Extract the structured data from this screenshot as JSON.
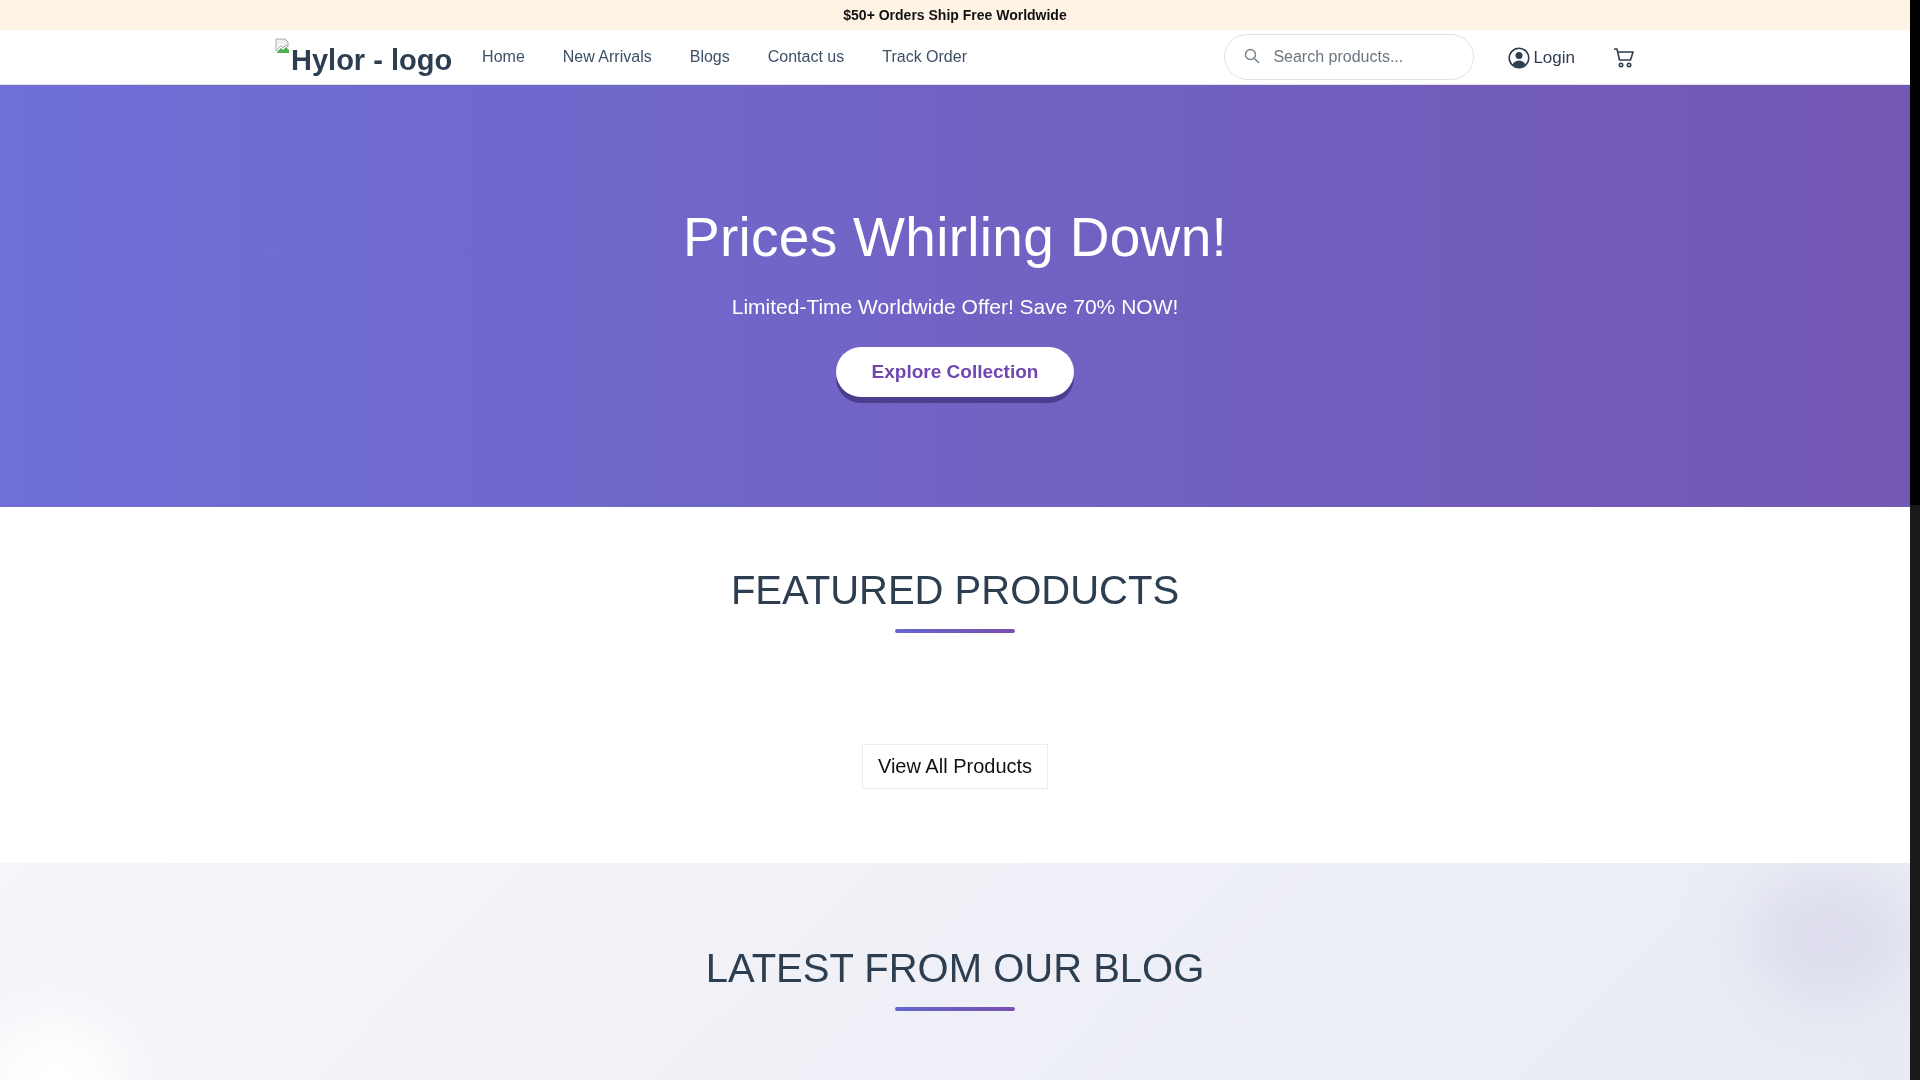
{
  "announcement": "$50+ Orders Ship Free Worldwide",
  "header": {
    "logo": "Hylor - logo",
    "nav": [
      {
        "label": "Home"
      },
      {
        "label": "New Arrivals"
      },
      {
        "label": "Blogs"
      },
      {
        "label": "Contact us"
      },
      {
        "label": "Track Order"
      }
    ],
    "search": {
      "placeholder": "Search products..."
    },
    "login": "Login"
  },
  "hero": {
    "title": "Prices Whirling Down!",
    "subtitle": "Limited-Time Worldwide Offer! Save 70% NOW!",
    "button": "Explore Collection"
  },
  "featured": {
    "title": "FEATURED PRODUCTS",
    "button": "View All Products"
  },
  "blog": {
    "title": "LATEST FROM OUR BLOG"
  }
}
